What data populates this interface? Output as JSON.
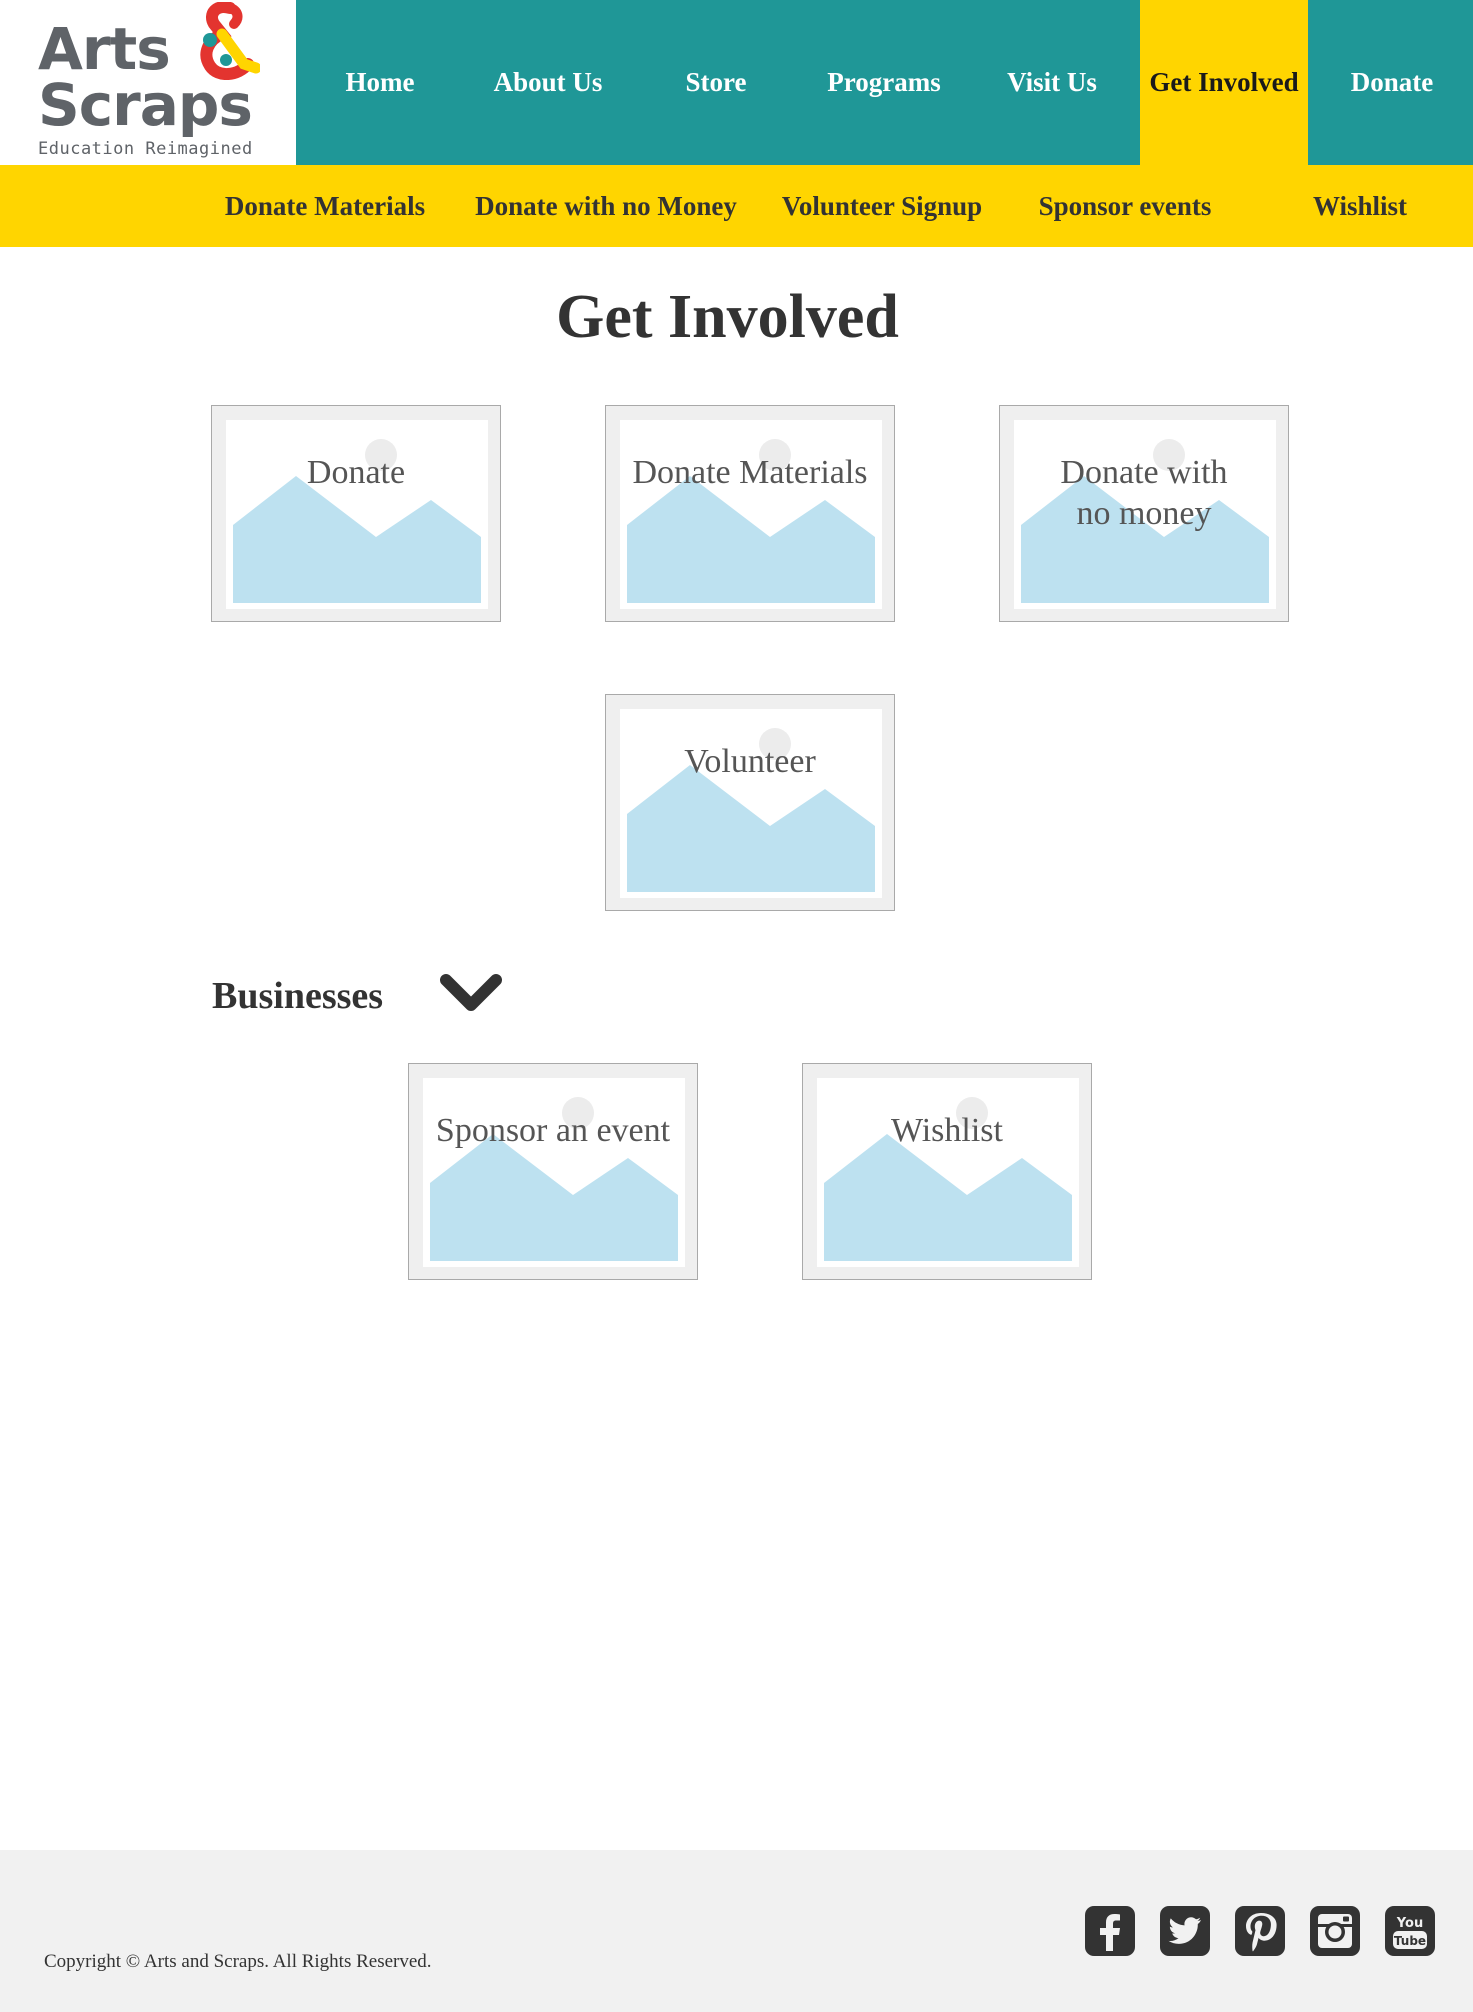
{
  "logo": {
    "line1": "Arts",
    "line2": "Scraps",
    "tagline": "Education Reimagined",
    "amp_colors": [
      "#e3342f",
      "#ffd500",
      "#1f9797"
    ]
  },
  "main_nav": [
    {
      "label": "Home"
    },
    {
      "label": "About Us"
    },
    {
      "label": "Store"
    },
    {
      "label": "Programs"
    },
    {
      "label": "Visit Us"
    },
    {
      "label": "Get Involved",
      "active": true
    },
    {
      "label": "Donate"
    }
  ],
  "sub_nav": [
    {
      "label": "Donate Materials"
    },
    {
      "label": "Donate with no Money"
    },
    {
      "label": "Volunteer Signup"
    },
    {
      "label": "Sponsor events"
    },
    {
      "label": "Wishlist"
    }
  ],
  "page_title": "Get Involved",
  "cards": [
    {
      "label": "Donate"
    },
    {
      "label": "Donate Materials"
    },
    {
      "label": "Donate with no money"
    },
    {
      "label": "Volunteer"
    }
  ],
  "businesses": {
    "title": "Businesses",
    "cards": [
      {
        "label": "Sponsor an event"
      },
      {
        "label": "Wishlist"
      }
    ]
  },
  "footer": {
    "copyright": "Copyright © Arts and Scraps. All Rights Reserved.",
    "social_icons": [
      "facebook-icon",
      "twitter-icon",
      "pinterest-icon",
      "instagram-icon",
      "youtube-icon"
    ]
  },
  "colors": {
    "teal": "#1f9797",
    "yellow": "#ffd500",
    "placeholder_blue": "#bde1f0"
  }
}
